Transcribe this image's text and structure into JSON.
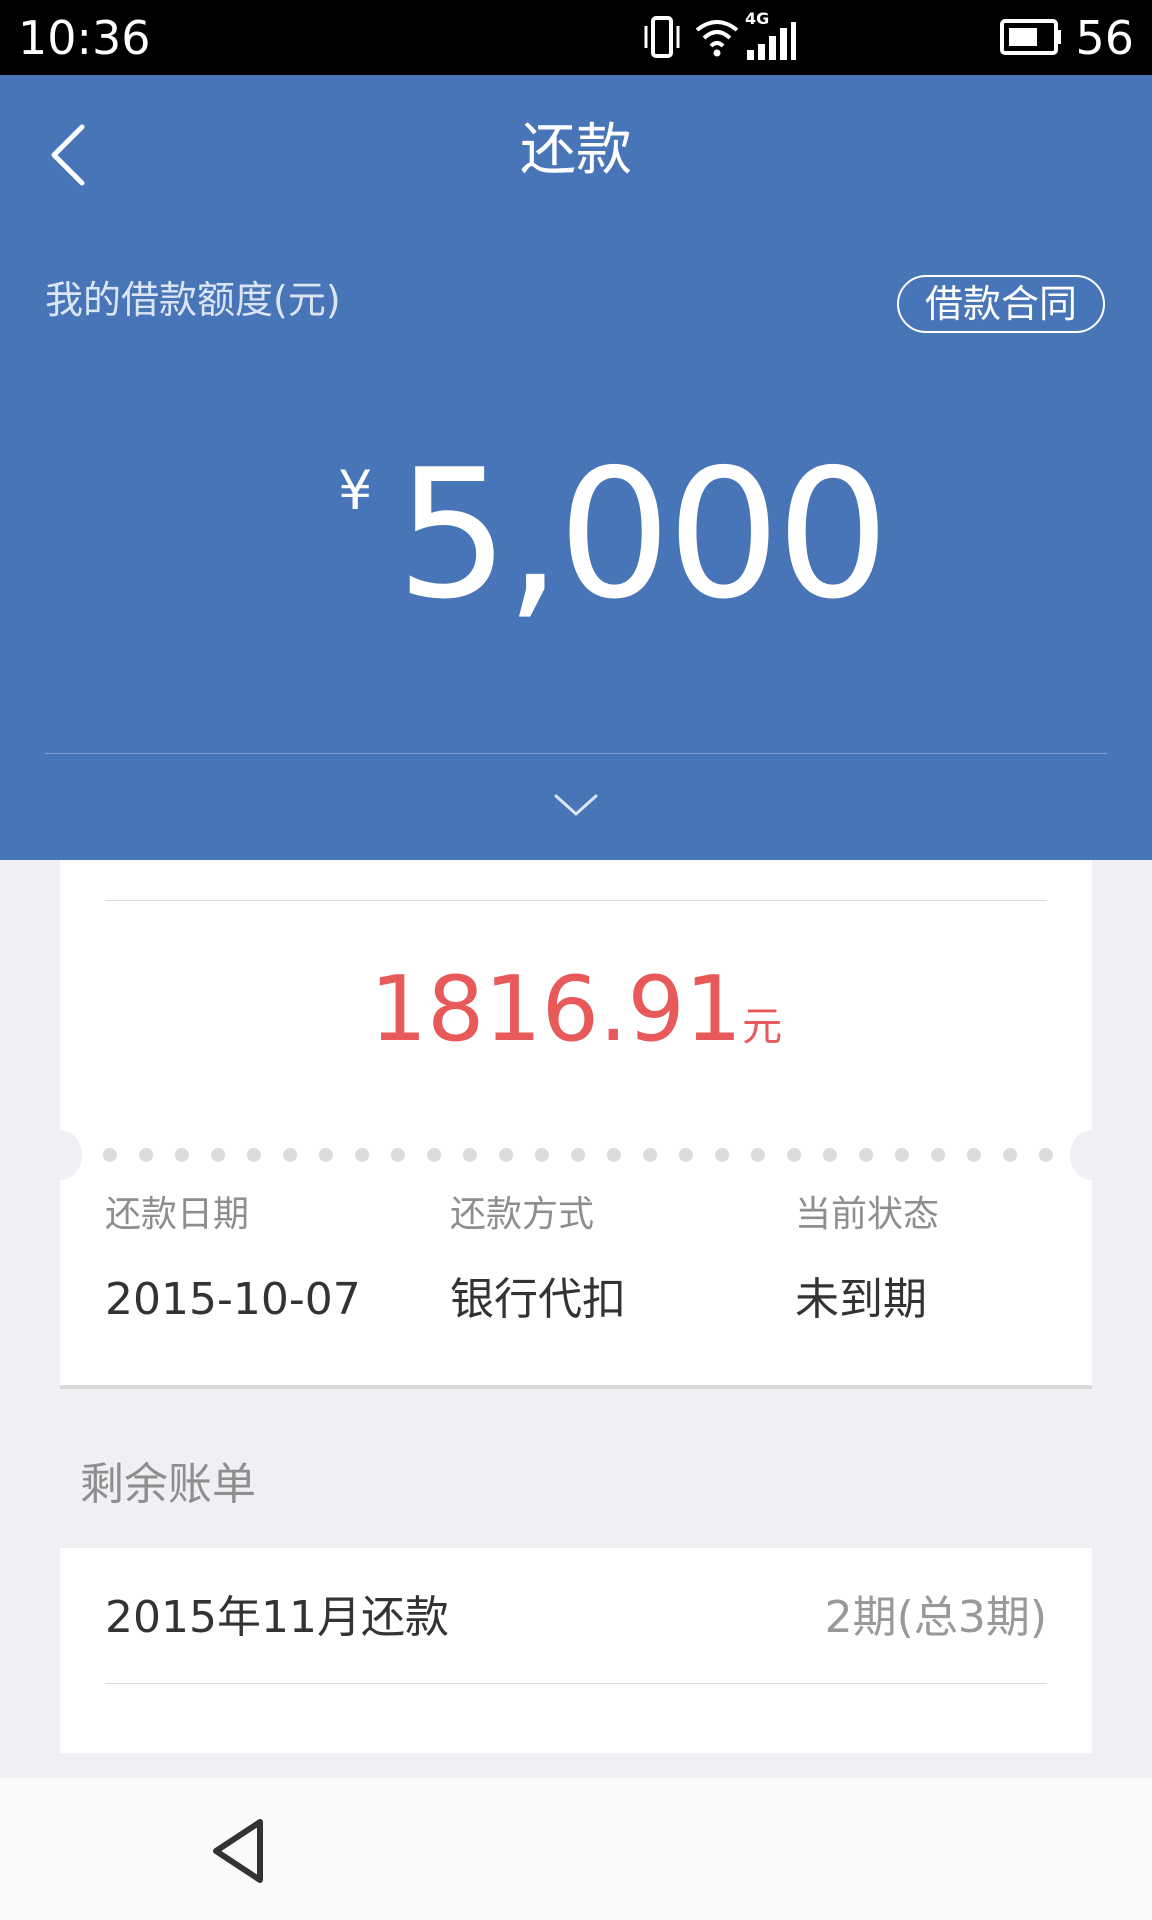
{
  "status_bar": {
    "time": "10:36",
    "network": "4G",
    "battery": "56",
    "icons": [
      "vibrate-icon",
      "wifi-icon",
      "signal-icon",
      "battery-icon"
    ]
  },
  "header": {
    "title": "还款",
    "limit_label": "我的借款额度(元)",
    "contract_button": "借款合同",
    "currency_symbol": "¥",
    "limit_amount": "5,000",
    "background_color": "#4874b8"
  },
  "current_bill": {
    "amount": "1816.91",
    "unit": "元",
    "amount_color": "#e85a5a",
    "columns": [
      {
        "label": "还款日期",
        "value": "2015-10-07"
      },
      {
        "label": "还款方式",
        "value": "银行代扣"
      },
      {
        "label": "当前状态",
        "value": "未到期"
      }
    ]
  },
  "remaining": {
    "title": "剩余账单",
    "items": [
      {
        "month": "2015年11月还款",
        "period": "2期(总3期)"
      }
    ]
  }
}
